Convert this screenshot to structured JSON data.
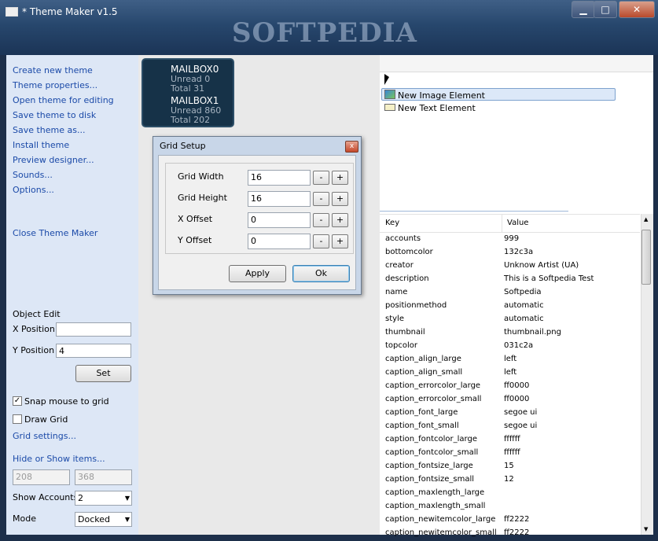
{
  "window": {
    "title": "* Theme Maker v1.5",
    "watermark": "SOFTPEDIA",
    "minimize": "▁",
    "maximize": "□",
    "close": "✕"
  },
  "left_menu": [
    "Create new theme",
    "Theme properties...",
    "Open theme for editing",
    "Save theme to disk",
    "Save theme as...",
    "Install theme",
    "Preview designer...",
    "Sounds...",
    "Options..."
  ],
  "close_label": "Close Theme Maker",
  "object_edit": {
    "heading": "Object Edit",
    "x_label": "X Position",
    "x_value": "",
    "y_label": "Y Position",
    "y_value": "4",
    "set_label": "Set"
  },
  "grid": {
    "snap_label": "Snap mouse to grid",
    "snap_checked": "✓",
    "draw_label": "Draw Grid",
    "settings_label": "Grid settings..."
  },
  "hide_show_label": "Hide or Show items...",
  "size": {
    "w": "208",
    "h": "368"
  },
  "show_accounts": {
    "label": "Show Accounts",
    "value": "2"
  },
  "mode": {
    "label": "Mode",
    "value": "Docked"
  },
  "mailboxes": [
    {
      "name": "MAILBOX0",
      "unread": "Unread 0",
      "total": "Total 31"
    },
    {
      "name": "MAILBOX1",
      "unread": "Unread 860",
      "total": "Total 202"
    }
  ],
  "dialog": {
    "title": "Grid Setup",
    "close": "x",
    "rows": [
      {
        "label": "Grid Width",
        "value": "16"
      },
      {
        "label": "Grid Height",
        "value": "16"
      },
      {
        "label": "X Offset",
        "value": "0"
      },
      {
        "label": "Y Offset",
        "value": "0"
      }
    ],
    "minus": "-",
    "plus": "+",
    "apply": "Apply",
    "ok": "Ok"
  },
  "tree": {
    "items": [
      "New Image Element",
      "New Text Element"
    ]
  },
  "props": {
    "key_header": "Key",
    "value_header": "Value",
    "rows": [
      [
        "accounts",
        "999"
      ],
      [
        "bottomcolor",
        "132c3a"
      ],
      [
        "creator",
        "Unknow Artist (UA)"
      ],
      [
        "description",
        "This is a Softpedia Test"
      ],
      [
        "name",
        "Softpedia"
      ],
      [
        "positionmethod",
        "automatic"
      ],
      [
        "style",
        "automatic"
      ],
      [
        "thumbnail",
        "thumbnail.png"
      ],
      [
        "topcolor",
        "031c2a"
      ],
      [
        "caption_align_large",
        "left"
      ],
      [
        "caption_align_small",
        "left"
      ],
      [
        "caption_errorcolor_large",
        "ff0000"
      ],
      [
        "caption_errorcolor_small",
        "ff0000"
      ],
      [
        "caption_font_large",
        "segoe ui"
      ],
      [
        "caption_font_small",
        "segoe ui"
      ],
      [
        "caption_fontcolor_large",
        "ffffff"
      ],
      [
        "caption_fontcolor_small",
        "ffffff"
      ],
      [
        "caption_fontsize_large",
        "15"
      ],
      [
        "caption_fontsize_small",
        "12"
      ],
      [
        "caption_maxlength_large",
        ""
      ],
      [
        "caption_maxlength_small",
        ""
      ],
      [
        "caption_newitemcolor_large",
        "ff2222"
      ],
      [
        "caption_newitemcolor_small",
        "ff2222"
      ]
    ]
  }
}
